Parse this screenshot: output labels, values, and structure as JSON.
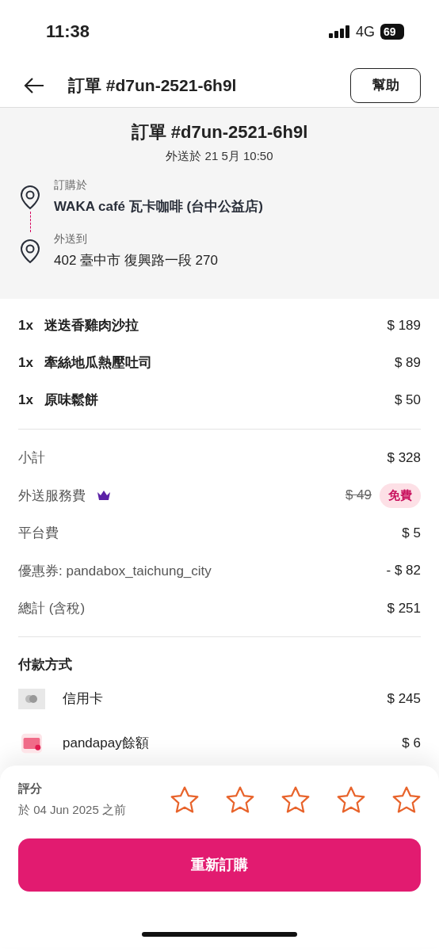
{
  "status_bar": {
    "time": "11:38",
    "network": "4G",
    "battery": "69"
  },
  "header": {
    "title": "訂單 #d7un-2521-6h9l",
    "help_button": "幫助"
  },
  "order_summary": {
    "title": "訂單 #d7un-2521-6h9l",
    "delivered_at": "外送於 21 5月 10:50",
    "locations": [
      {
        "label": "訂購於",
        "value": "WAKA café 瓦卡咖啡 (台中公益店)",
        "kind": "restaurant"
      },
      {
        "label": "外送到",
        "value": "402 臺中市 復興路一段 270",
        "kind": "address"
      }
    ]
  },
  "items": [
    {
      "quantity": "1x",
      "name": "迷迭香雞肉沙拉",
      "price": "$ 189"
    },
    {
      "quantity": "1x",
      "name": "牽絲地瓜熱壓吐司",
      "price": "$ 89"
    },
    {
      "quantity": "1x",
      "name": "原味鬆餅",
      "price": "$ 50"
    }
  ],
  "fees": [
    {
      "kind": "plain",
      "label": "小計",
      "amount": "$ 328"
    },
    {
      "kind": "discounted",
      "label": "外送服務費",
      "original_amount": "$ 49",
      "badge": "免費"
    },
    {
      "kind": "plain",
      "label": "平台費",
      "amount": "$ 5"
    },
    {
      "kind": "plain",
      "label": "優惠券: pandabox_taichung_city",
      "amount": "- $ 82"
    },
    {
      "kind": "plain",
      "label": "總計 (含稅)",
      "amount": "$ 251"
    }
  ],
  "payment": {
    "title": "付款方式",
    "methods": [
      {
        "kind": "card",
        "name": "信用卡",
        "amount": "$ 245"
      },
      {
        "kind": "wallet",
        "name": "pandapay餘額",
        "amount": "$ 6"
      }
    ]
  },
  "rating": {
    "label": "評分",
    "deadline": "於 04 Jun 2025 之前",
    "stars": 0
  },
  "reorder_button": "重新訂購"
}
